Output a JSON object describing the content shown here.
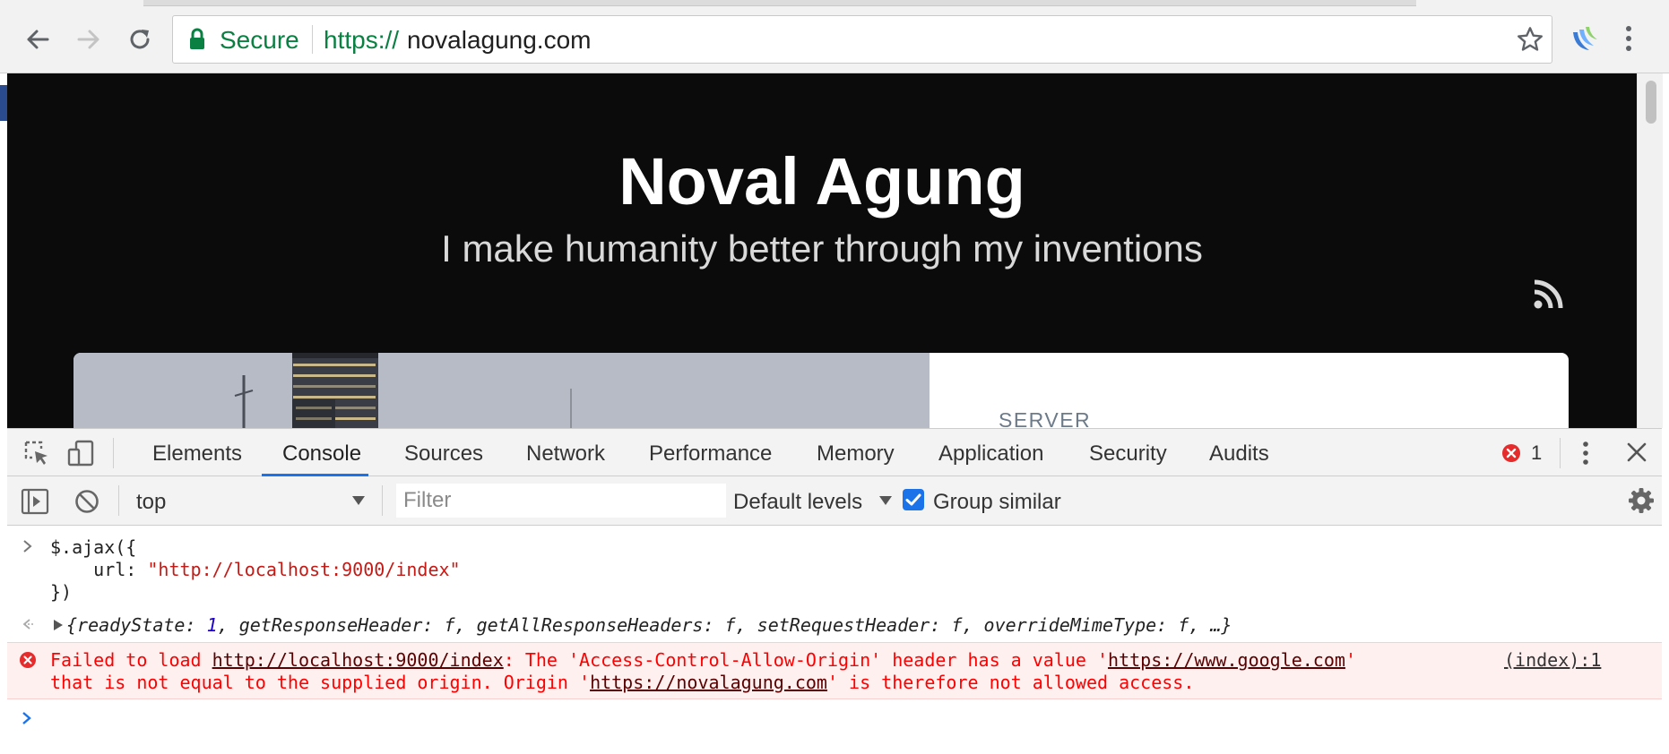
{
  "browser": {
    "security_label": "Secure",
    "url_scheme": "https://",
    "url_host": "novalagung.com"
  },
  "page": {
    "title": "Noval Agung",
    "tagline": "I make humanity better through my inventions",
    "card_category": "SERVER"
  },
  "devtools": {
    "tabs": [
      "Elements",
      "Console",
      "Sources",
      "Network",
      "Performance",
      "Memory",
      "Application",
      "Security",
      "Audits"
    ],
    "active_tab": "Console",
    "error_count": "1",
    "toolbar": {
      "context": "top",
      "filter_placeholder": "Filter",
      "levels": "Default levels",
      "group_similar_label": "Group similar",
      "group_similar_checked": true
    },
    "console": {
      "input_line1": "$.ajax({",
      "input_line2_key": "    url: ",
      "input_line2_value": "\"http://localhost:9000/index\"",
      "input_line3": "})",
      "result_prefix": "{",
      "result_k1": "readyState",
      "result_v1": "1",
      "result_rest": ", getResponseHeader: f, getAllResponseHeaders: f, setRequestHeader: f, overrideMimeType: f, …}",
      "error_part1": "Failed to load ",
      "error_link1": "http://localhost:9000/index",
      "error_part2": ": The 'Access-Control-Allow-Origin' header has a value '",
      "error_link2": "https://www.google.com",
      "error_part3": "'",
      "error_source": "(index):1",
      "error_line2_part1": "that is not equal to the supplied origin. Origin '",
      "error_link3": "https://novalagung.com",
      "error_line2_part2": "' is therefore not allowed access."
    }
  },
  "colors": {
    "secure_green": "#0b8043",
    "accent_blue": "#1a73e8",
    "error_red": "#ff0000",
    "page_background": "#0b0b0c"
  }
}
